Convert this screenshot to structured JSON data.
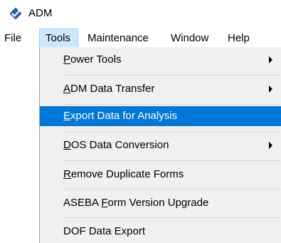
{
  "window": {
    "title": "ADM"
  },
  "menubar": {
    "items": [
      {
        "label": "File"
      },
      {
        "label": "Tools"
      },
      {
        "label": "Maintenance"
      },
      {
        "label": "Window"
      },
      {
        "label": "Help"
      }
    ],
    "active": "Tools"
  },
  "tools_menu": {
    "items": [
      {
        "pre": "",
        "mn": "P",
        "post": "ower Tools",
        "submenu": true
      },
      {
        "pre": "",
        "mn": "A",
        "post": "DM Data Transfer",
        "submenu": true
      },
      {
        "pre": "",
        "mn": "E",
        "post": "xport Data for Analysis",
        "submenu": false
      },
      {
        "pre": "",
        "mn": "D",
        "post": "OS Data Conversion",
        "submenu": true
      },
      {
        "pre": "",
        "mn": "R",
        "post": "emove Duplicate Forms",
        "submenu": false
      },
      {
        "pre": "ASEBA ",
        "mn": "F",
        "post": "orm Version Upgrade",
        "submenu": false
      },
      {
        "pre": "DOF Data Export",
        "mn": "",
        "post": "",
        "submenu": false
      }
    ],
    "highlighted": "Export Data for Analysis"
  },
  "colors": {
    "highlight": "#0078d7",
    "menu_background": "#f0f0f0",
    "menubar_active": "#cce8ff",
    "app_icon_blue": "#1b5fb4"
  },
  "icons": {
    "app": "adm-logo-icon",
    "submenu": "chevron-right-icon"
  }
}
